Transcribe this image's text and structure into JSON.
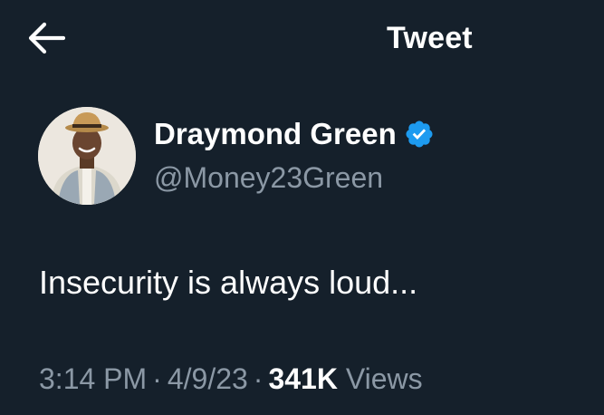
{
  "header": {
    "back_icon": "arrow-left-icon",
    "title": "Tweet"
  },
  "author": {
    "display_name": "Draymond Green",
    "verified_icon": "verified-badge-icon",
    "verified_color": "#1d9bf0",
    "handle": "@Money23Green"
  },
  "tweet": {
    "text": "Insecurity is always loud..."
  },
  "meta": {
    "time": "3:14 PM",
    "separator": "·",
    "date": "4/9/23",
    "views_count": "341K",
    "views_label": "Views"
  },
  "colors": {
    "background": "#15202b",
    "primary_text": "#ffffff",
    "secondary_text": "#8b98a5",
    "accent": "#1d9bf0"
  }
}
